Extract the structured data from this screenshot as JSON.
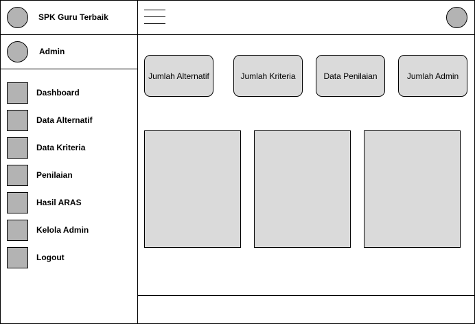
{
  "brand": {
    "title": "SPK Guru Terbaik",
    "logo_icon": "circle-logo-icon"
  },
  "user": {
    "name": "Admin",
    "avatar_icon": "user-avatar-icon"
  },
  "sidebar": {
    "items": [
      {
        "label": "Dashboard",
        "icon": "dashboard-icon"
      },
      {
        "label": "Data Alternatif",
        "icon": "alternatif-icon"
      },
      {
        "label": "Data Kriteria",
        "icon": "kriteria-icon"
      },
      {
        "label": "Penilaian",
        "icon": "penilaian-icon"
      },
      {
        "label": "Hasil ARAS",
        "icon": "hasil-icon"
      },
      {
        "label": "Kelola Admin",
        "icon": "admin-icon"
      },
      {
        "label": "Logout",
        "icon": "logout-icon"
      }
    ]
  },
  "header": {
    "menu_icon": "hamburger-menu-icon",
    "profile_icon": "profile-avatar-icon"
  },
  "cards": [
    {
      "label": "Jumlah Alternatif"
    },
    {
      "label": "Jumlah Kriteria"
    },
    {
      "label": "Data Penilaian"
    },
    {
      "label": "Jumlah Admin"
    }
  ],
  "colors": {
    "placeholder_fill": "#dadada",
    "icon_fill": "#b3b3b3",
    "border": "#000000"
  }
}
